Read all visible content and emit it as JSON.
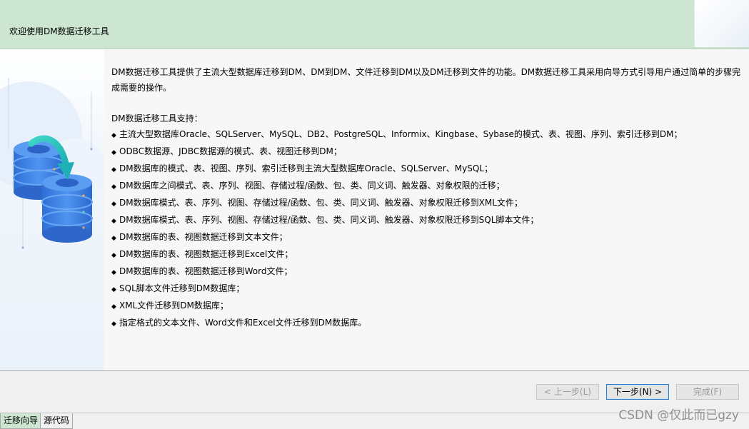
{
  "header": {
    "title": "欢迎使用DM数据迁移工具"
  },
  "main": {
    "intro_line1": "DM数据迁移工具提供了主流大型数据库迁移到DM、DM到DM、文件迁移到DM以及DM迁移到文件的功能。DM数据迁移工具采用向导方式引导用户通过简单的步骤完",
    "intro_line2": "成需要的操作。",
    "support_title": "DM数据迁移工具支持：",
    "bullet": "◆",
    "features": [
      "主流大型数据库Oracle、SQLServer、MySQL、DB2、PostgreSQL、Informix、Kingbase、Sybase的模式、表、视图、序列、索引迁移到DM；",
      "ODBC数据源、JDBC数据源的模式、表、视图迁移到DM；",
      "DM数据库的模式、表、视图、序列、索引迁移到主流大型数据库Oracle、SQLServer、MySQL；",
      "DM数据库之间模式、表、序列、视图、存储过程/函数、包、类、同义词、触发器、对象权限的迁移；",
      "DM数据库模式、表、序列、视图、存储过程/函数、包、类、同义词、触发器、对象权限迁移到XML文件；",
      "DM数据库模式、表、序列、视图、存储过程/函数、包、类、同义词、触发器、对象权限迁移到SQL脚本文件；",
      "DM数据库的表、视图数据迁移到文本文件；",
      "DM数据库的表、视图数据迁移到Excel文件；",
      "DM数据库的表、视图数据迁移到Word文件；",
      "SQL脚本文件迁移到DM数据库；",
      "XML文件迁移到DM数据库；",
      "指定格式的文本文件、Word文件和Excel文件迁移到DM数据库。"
    ]
  },
  "footer": {
    "prev_label": "< 上一步(L)",
    "next_label": "下一步(N) >",
    "finish_label": "完成(F)"
  },
  "tabs": [
    "迁移向导",
    "源代码"
  ],
  "watermark": "CSDN @仅此而已gzy",
  "colors": {
    "header_bg": "#cde6d2",
    "accent_blue": "#2b7ad1",
    "db_blue": "#3f7fe0",
    "arrow_teal": "#2ec7c0"
  }
}
